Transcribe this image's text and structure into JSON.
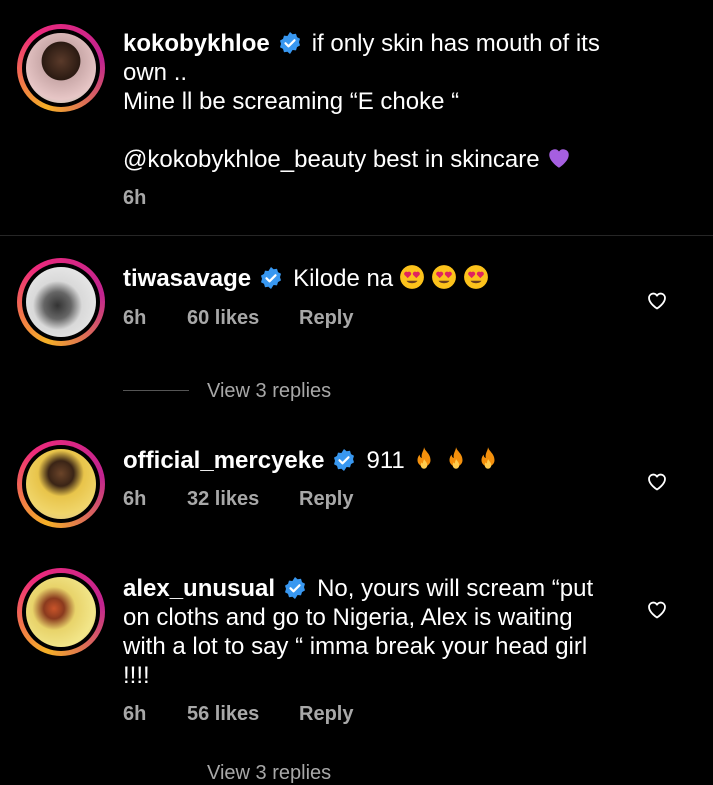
{
  "caption": {
    "username": "kokobykhloe",
    "text_line1": "if only skin has mouth of its",
    "text_line2": "own ..",
    "text_line3": "Mine ll be  screaming “E choke “",
    "mention": "@kokobykhloe_beauty",
    "text_line4_rest": " best in skincare",
    "emoji": "purple-heart",
    "time": "6h"
  },
  "comments": [
    {
      "username": "tiwasavage",
      "text": "Kilode na",
      "emojis": [
        "heart-eyes",
        "heart-eyes",
        "heart-eyes"
      ],
      "time": "6h",
      "likes": "60 likes",
      "reply": "Reply",
      "view_replies": "View 3 replies"
    },
    {
      "username": "official_mercyeke",
      "text": "911",
      "emojis": [
        "fire",
        "fire",
        "fire"
      ],
      "time": "6h",
      "likes": "32 likes",
      "reply": "Reply"
    },
    {
      "username": "alex_unusual",
      "text_line1": "No, yours will scream “put",
      "text_line2": "on cloths and go to Nigeria, Alex is waiting",
      "text_line3": "with a lot to say “ imma break your head girl",
      "text_line4": "!!!!",
      "time": "6h",
      "likes": "56 likes",
      "reply": "Reply",
      "view_replies_partial": "View 3 replies"
    }
  ],
  "colors": {
    "background": "#000000",
    "secondary_text": "#a8a8a8",
    "verified": "#3897f0"
  }
}
